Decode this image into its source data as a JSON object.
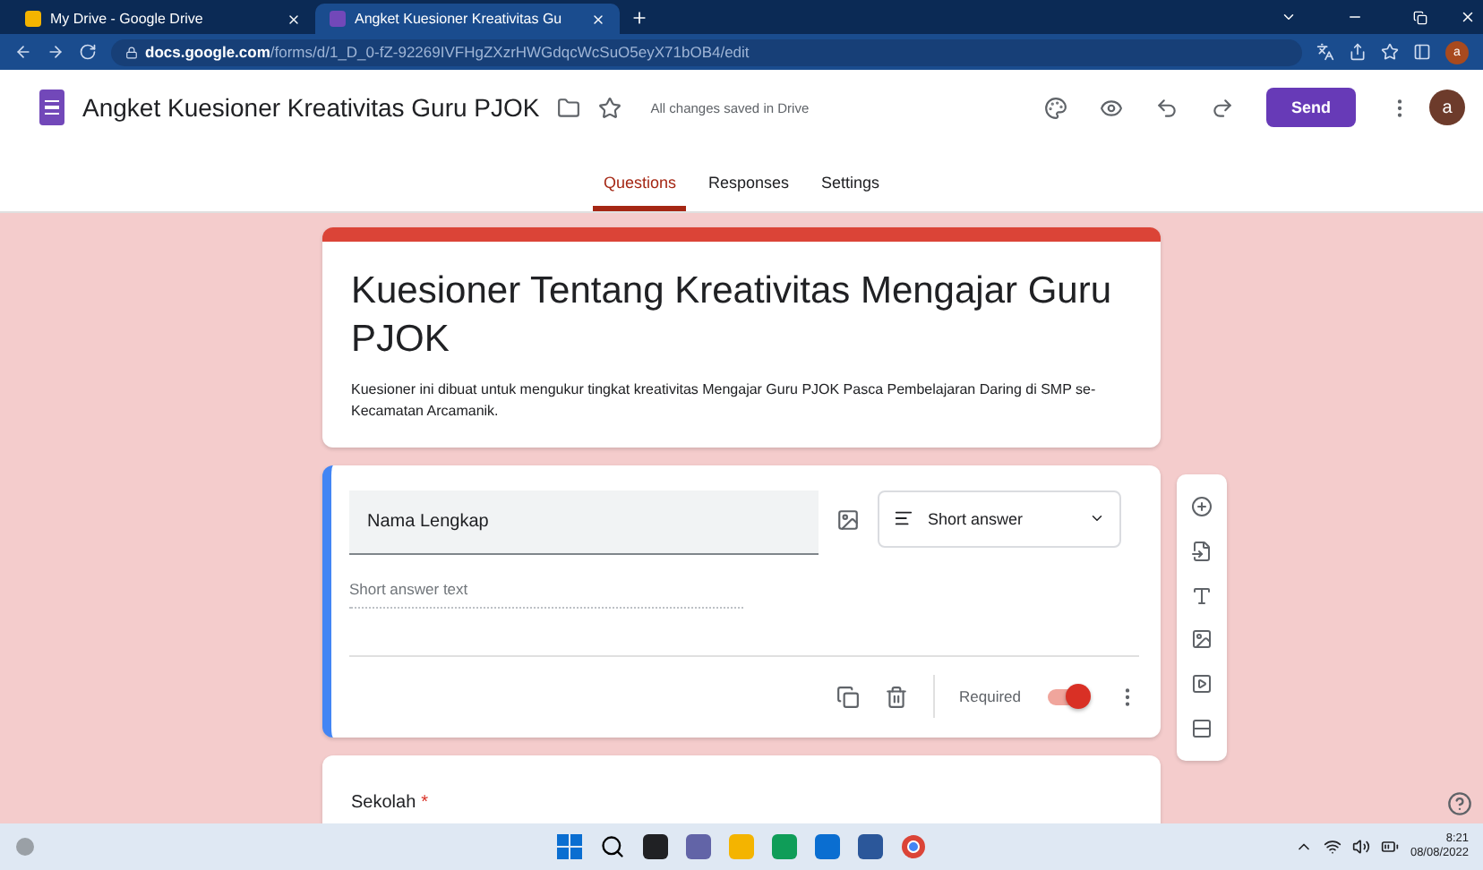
{
  "browser": {
    "tabs": [
      {
        "title": "My Drive - Google Drive",
        "selected": false,
        "kind": "drive"
      },
      {
        "title": "Angket Kuesioner Kreativitas Gu",
        "selected": true,
        "kind": "forms"
      }
    ],
    "url_host": "docs.google.com",
    "url_path": "/forms/d/1_D_0-fZ-92269IVFHgZXzrHWGdqcWcSuO5eyX71bOB4/edit",
    "profile": "a"
  },
  "app": {
    "doc_title": "Angket Kuesioner Kreativitas Guru PJOK",
    "save_status": "All changes saved in Drive",
    "send": "Send",
    "avatar": "a"
  },
  "tabs": [
    {
      "label": "Questions",
      "selected": true
    },
    {
      "label": "Responses",
      "selected": false
    },
    {
      "label": "Settings",
      "selected": false
    }
  ],
  "form": {
    "title": "Kuesioner Tentang Kreativitas Mengajar Guru PJOK",
    "description": "Kuesioner ini dibuat untuk mengukur tingkat kreativitas Mengajar Guru PJOK Pasca Pembelajaran Daring di SMP se-Kecamatan Arcamanik."
  },
  "question": {
    "title": "Nama Lengkap",
    "type": "Short answer",
    "answer_placeholder": "Short answer text",
    "required_label": "Required",
    "required": true
  },
  "next_question": {
    "title": "Sekolah",
    "required": true,
    "required_mark": "*"
  },
  "taskbar": {
    "time": "8:21",
    "date": "08/08/2022"
  }
}
